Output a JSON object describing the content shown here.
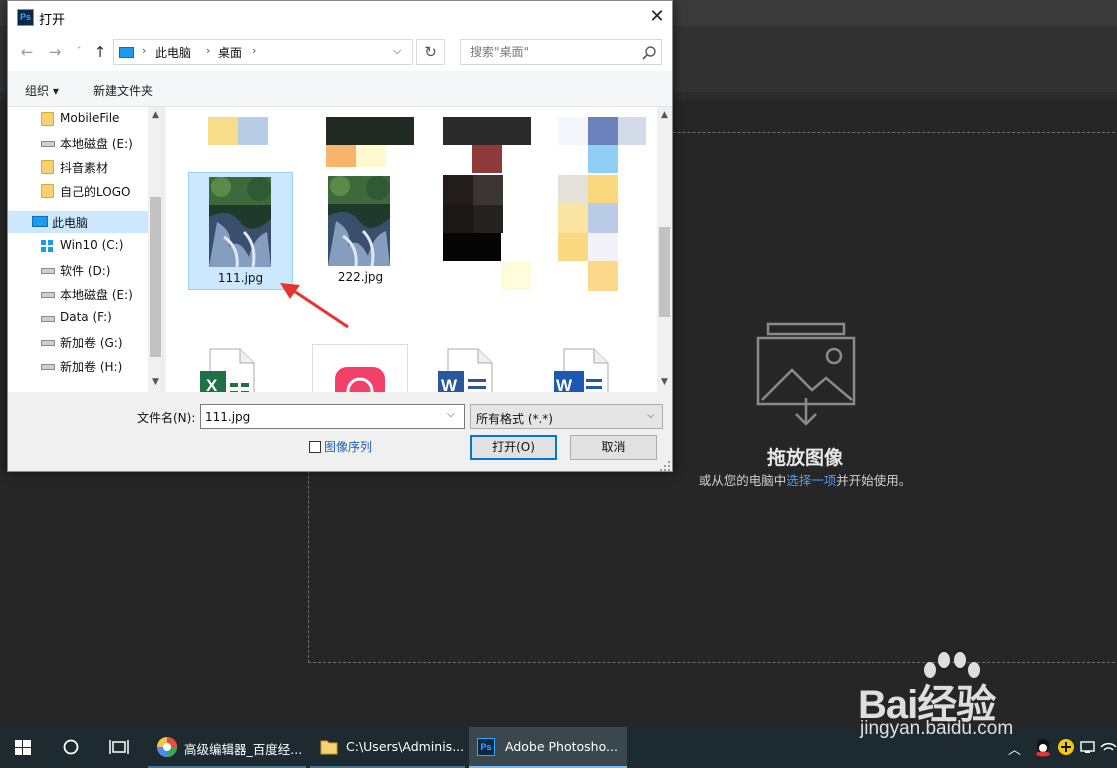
{
  "dialog": {
    "title": "打开",
    "app_logo": "Ps",
    "close_glyph": "✕",
    "nav": {
      "back": "←",
      "forward": "→",
      "recent": "˅",
      "up": "↑"
    },
    "breadcrumb": [
      "此电脑",
      "桌面"
    ],
    "breadcrumb_sep": "›",
    "address_dropdown": "⌵",
    "refresh": "↻",
    "search_placeholder": "搜索\"桌面\"",
    "toolbar": {
      "organize": "组织 ▾",
      "new_folder": "新建文件夹"
    },
    "sidebar": [
      {
        "label": "MobileFile",
        "icon": "folder-icon"
      },
      {
        "label": "本地磁盘 (E:)",
        "icon": "drive-icon"
      },
      {
        "label": "抖音素材",
        "icon": "folder-icon"
      },
      {
        "label": "自己的LOGO",
        "icon": "folder-icon"
      },
      {
        "label": "此电脑",
        "icon": "computer-icon",
        "selected": true
      },
      {
        "label": "Win10 (C:)",
        "icon": "windows-drive-icon"
      },
      {
        "label": "软件 (D:)",
        "icon": "drive-icon"
      },
      {
        "label": "本地磁盘 (E:)",
        "icon": "drive-icon"
      },
      {
        "label": "Data (F:)",
        "icon": "drive-icon"
      },
      {
        "label": "新加卷 (G:)",
        "icon": "drive-icon"
      },
      {
        "label": "新加卷 (H:)",
        "icon": "drive-icon"
      }
    ],
    "files": [
      {
        "name": "111.jpg",
        "selected": true
      },
      {
        "name": "222.jpg",
        "selected": false
      }
    ],
    "filename_label": "文件名(N):",
    "filename_value": "111.jpg",
    "filetype_value": "所有格式 (*.*)",
    "image_sequence_label": "图像序列",
    "open_button": "打开(O)",
    "cancel_button": "取消"
  },
  "photoshop": {
    "drop_title": "拖放图像",
    "drop_sub_prefix": "或从您的电脑中",
    "drop_sub_link": "选择一项",
    "drop_sub_suffix": "并开始使用。"
  },
  "taskbar": {
    "tasks": [
      {
        "label": "高级编辑器_百度经...",
        "icon": "browser-icon"
      },
      {
        "label": "C:\\Users\\Adminis...",
        "icon": "folder-icon"
      },
      {
        "label": "Adobe Photosho...",
        "icon": "photoshop-icon",
        "active": true
      }
    ],
    "tray_chevron": "︿"
  },
  "watermark": {
    "brand": "Bai经验",
    "url": "jingyan.baidu.com"
  },
  "colors": {
    "accent": "#0078d7",
    "selection": "#cce8ff",
    "link": "#4b9cf5",
    "ps_bg": "#262626",
    "taskbar": "#1d2b30"
  }
}
